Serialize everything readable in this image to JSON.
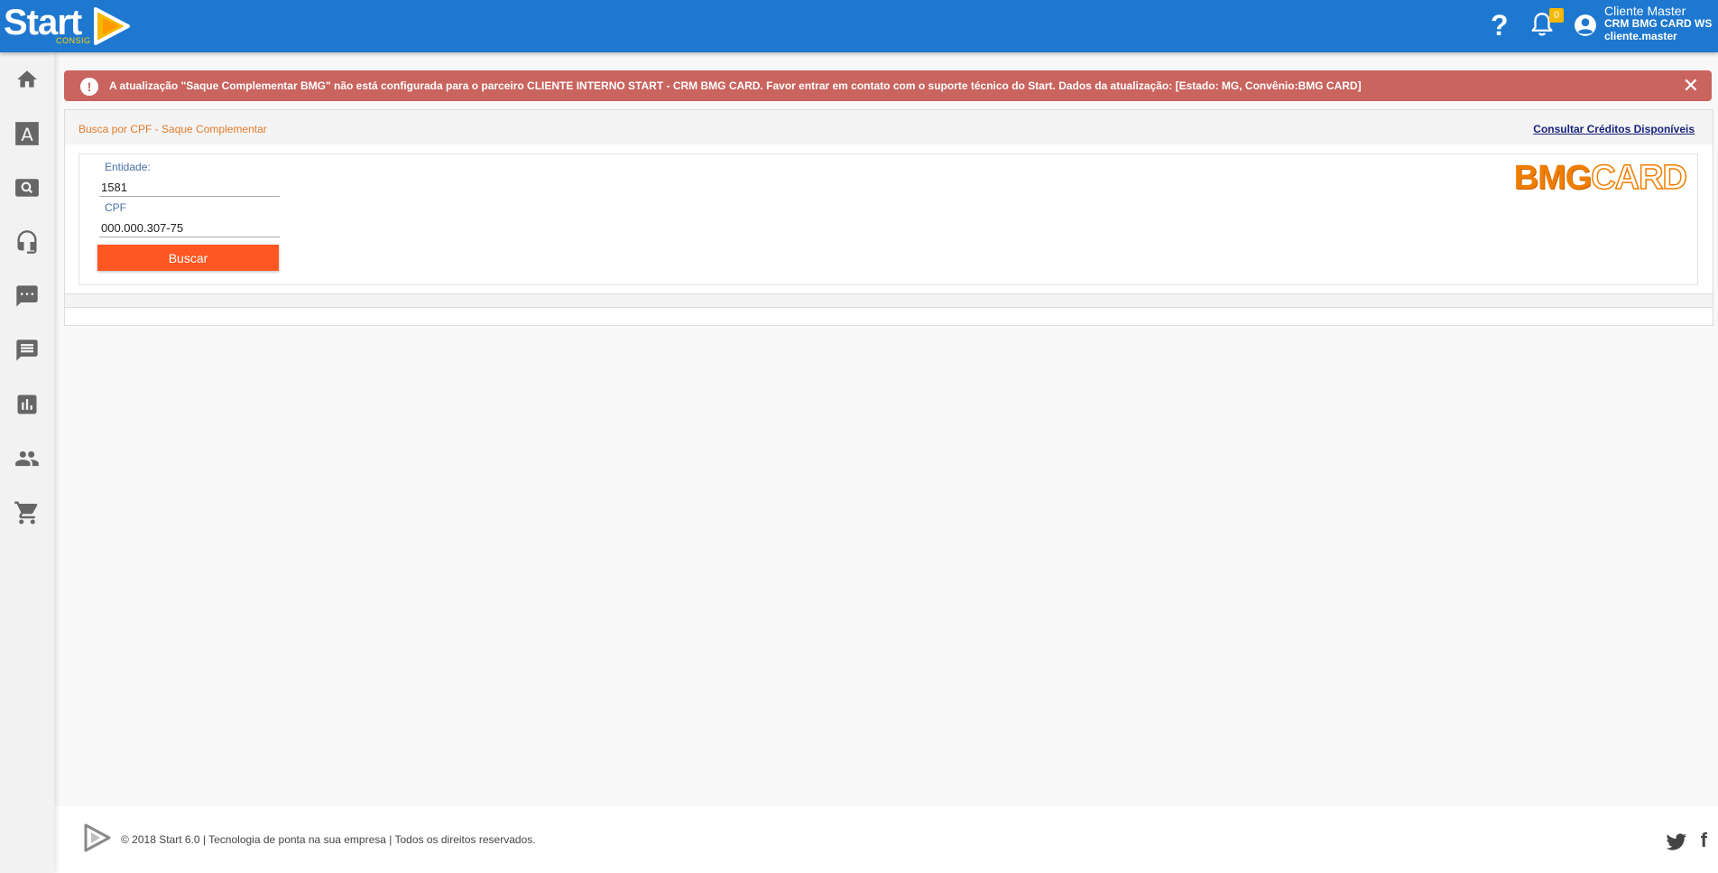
{
  "header": {
    "logo_text": "Start",
    "logo_sub": "CONSIG",
    "help_glyph": "?",
    "notifications_count": "0",
    "user": {
      "name": "Cliente Master",
      "company": "CRM BMG CARD WS",
      "login": "cliente.master"
    }
  },
  "sidebar": {
    "items": [
      {
        "icon": "home-icon"
      },
      {
        "icon": "font-icon",
        "glyph": "A"
      },
      {
        "icon": "search-icon"
      },
      {
        "icon": "headset-icon"
      },
      {
        "icon": "chat-icon"
      },
      {
        "icon": "message-icon"
      },
      {
        "icon": "bar-chart-icon"
      },
      {
        "icon": "people-icon"
      },
      {
        "icon": "cart-icon"
      }
    ]
  },
  "alert": {
    "icon_glyph": "!",
    "message": "A atualização \"Saque Complementar BMG\" não está configurada para o parceiro CLIENTE INTERNO START - CRM BMG CARD. Favor entrar em contato com o suporte técnico do Start. Dados da atualização: [Estado: MG, Convênio:BMG CARD]",
    "close_glyph": "✕"
  },
  "panel": {
    "title": "Busca por CPF - Saque Complementar",
    "consult_link": "Consultar Créditos Disponíveis",
    "entidade_label": "Entidade:",
    "entidade_value": "1581",
    "cpf_label": "CPF",
    "cpf_value": "000.000.307-75",
    "buscar_label": "Buscar",
    "brand_solid": "BMG",
    "brand_outline": "CARD"
  },
  "footer": {
    "text": "© 2018 Start 6.0 | Tecnologia de ponta na sua empresa | Todos os direitos reservados.",
    "fb_glyph": "f"
  },
  "colors": {
    "topbar": "#1e78d0",
    "alert": "#c9645f",
    "accent_button": "#ff5722",
    "brand_orange": "#ef7d00"
  }
}
